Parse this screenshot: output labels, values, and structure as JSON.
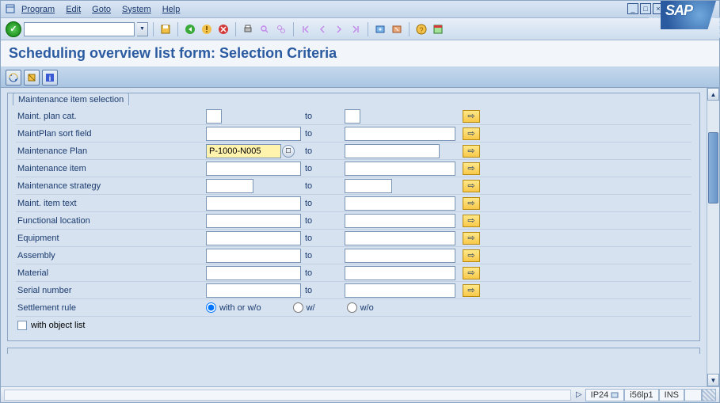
{
  "menu": {
    "items": [
      "Program",
      "Edit",
      "Goto",
      "System",
      "Help"
    ]
  },
  "title": "Scheduling overview list form: Selection Criteria",
  "group": {
    "legend": "Maintenance item selection",
    "rows": [
      {
        "label": "Maint. plan cat.",
        "to": "to"
      },
      {
        "label": "MaintPlan sort field",
        "to": "to"
      },
      {
        "label": "Maintenance Plan",
        "to": "to",
        "value": "P-1000-N005"
      },
      {
        "label": "Maintenance item",
        "to": "to"
      },
      {
        "label": "Maintenance strategy",
        "to": "to"
      },
      {
        "label": "Maint. item text",
        "to": "to"
      },
      {
        "label": "Functional location",
        "to": "to"
      },
      {
        "label": "Equipment",
        "to": "to"
      },
      {
        "label": "Assembly",
        "to": "to"
      },
      {
        "label": "Material",
        "to": "to"
      },
      {
        "label": "Serial number",
        "to": "to"
      }
    ],
    "settlement_label": "Settlement rule",
    "settlement_opts": [
      "with or w/o",
      "w/",
      "w/o"
    ],
    "objlist_label": "with object list"
  },
  "status": {
    "tcode": "IP24",
    "sys": "i56lp1",
    "mode": "INS"
  },
  "logo": "SAP"
}
